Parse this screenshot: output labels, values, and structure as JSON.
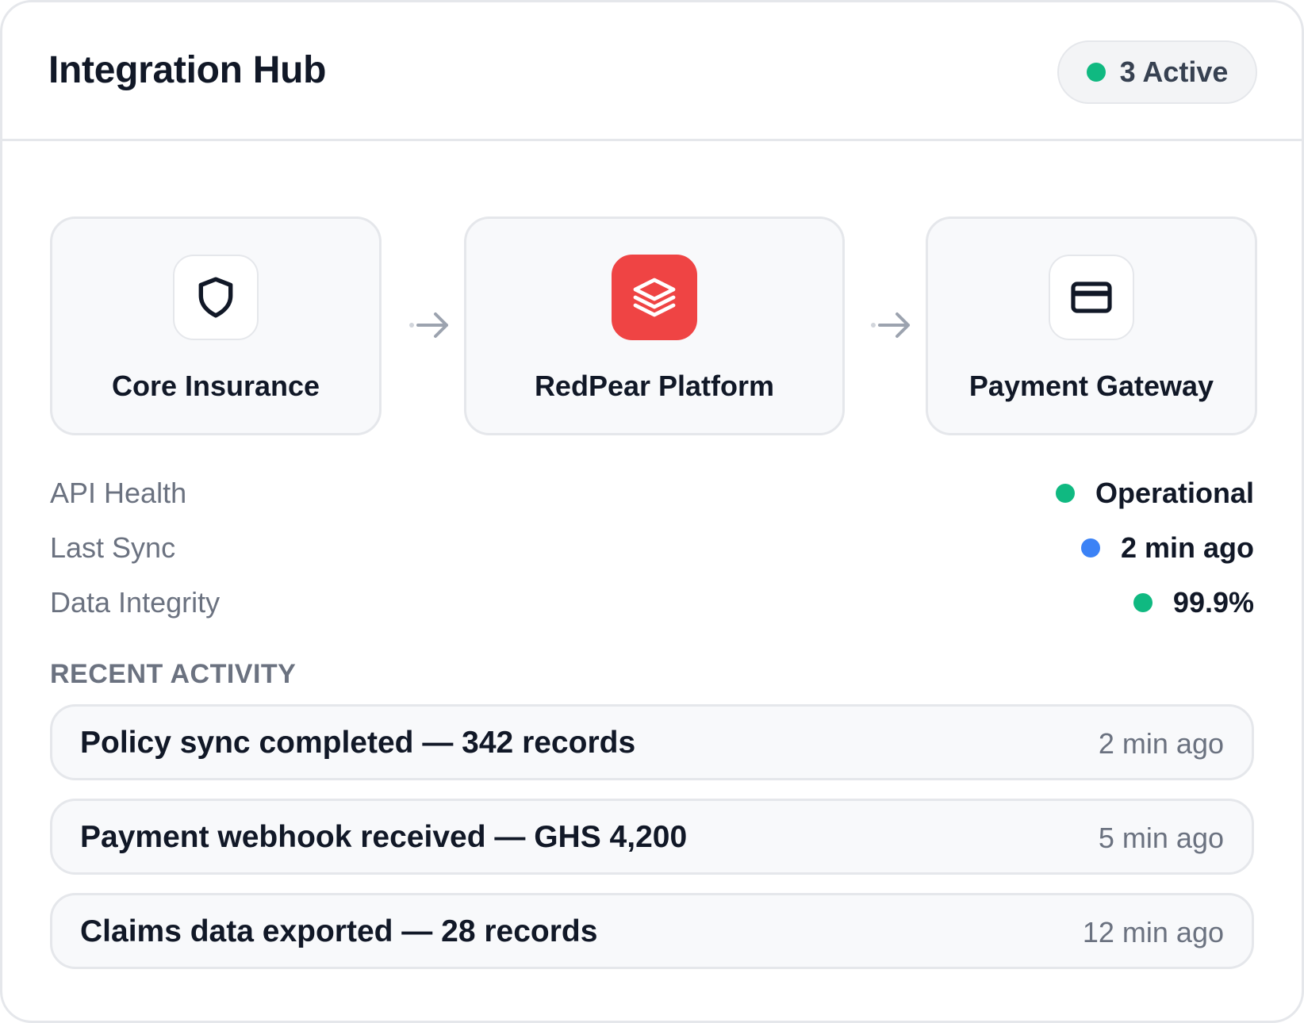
{
  "header": {
    "title": "Integration Hub",
    "status_badge": {
      "label": "3 Active",
      "dot_color": "#10b981"
    }
  },
  "flow": {
    "nodes": [
      {
        "label": "Core Insurance",
        "icon": "shield-icon"
      },
      {
        "label": "RedPear Platform",
        "icon": "layers-icon",
        "accent": "#ef4444"
      },
      {
        "label": "Payment Gateway",
        "icon": "credit-card-icon"
      }
    ],
    "connector_icon": "arrow-right-icon"
  },
  "metrics": [
    {
      "key": "API Health",
      "value": "Operational",
      "dot_color": "#10b981"
    },
    {
      "key": "Last Sync",
      "value": "2 min ago",
      "dot_color": "#3b82f6"
    },
    {
      "key": "Data Integrity",
      "value": "99.9%",
      "dot_color": "#10b981"
    }
  ],
  "recent_activity": {
    "title": "RECENT ACTIVITY",
    "items": [
      {
        "message": "Policy sync completed — 342 records",
        "time": "2 min ago"
      },
      {
        "message": "Payment webhook received — GHS 4,200",
        "time": "5 min ago"
      },
      {
        "message": "Claims data exported — 28 records",
        "time": "12 min ago"
      }
    ]
  }
}
